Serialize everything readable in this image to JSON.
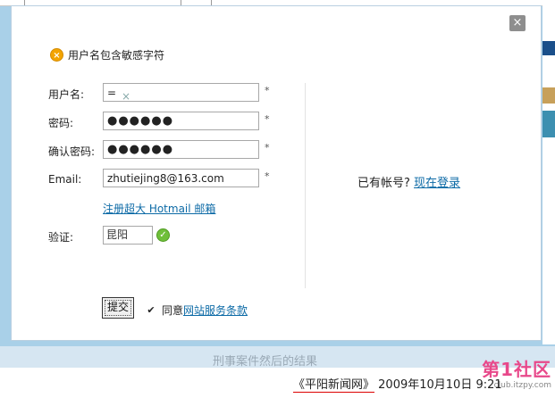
{
  "dialog": {
    "close_glyph": "×",
    "error_message": "用户名包含敏感字符",
    "fields": {
      "username": {
        "label": "用户名:",
        "value": "= ",
        "clear_glyph": "×"
      },
      "password": {
        "label": "密码:",
        "value": "●●●●●●"
      },
      "confirm_password": {
        "label": "确认密码:",
        "value": "●●●●●●"
      },
      "email": {
        "label": "Email:",
        "value": "zhutiejing8@163.com"
      },
      "captcha": {
        "label": "验证:",
        "value": "昆阳"
      }
    },
    "required_mark": "*",
    "register_link": "注册超大 Hotmail 邮箱",
    "have_account_text": "已有帐号?",
    "login_link": "现在登录",
    "submit_label": "提交",
    "agree_text": "同意",
    "terms_link": "网站服务条款"
  },
  "background": {
    "faded_text": "刑事案件然后的结果",
    "footer_source": "《平阳新闻网》",
    "footer_date": "2009年10月10日",
    "footer_time": "9:21",
    "watermark_logo": "第1社区",
    "watermark_url": "club.itzpy.com"
  },
  "colors": {
    "accent_link": "#0c6aa6",
    "error_icon": "#f3a400",
    "success_icon": "#6fbf3a"
  },
  "icons": {
    "close": "close-icon",
    "error": "error-icon",
    "valid": "check-icon",
    "agree": "checkmark-icon"
  }
}
